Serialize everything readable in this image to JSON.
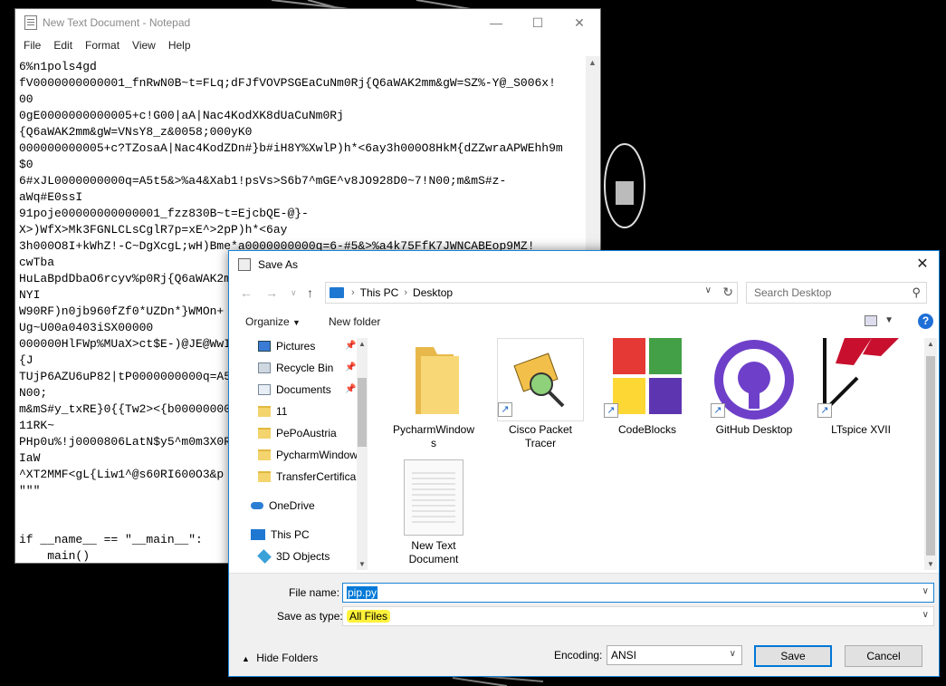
{
  "notepad": {
    "title": "New Text Document - Notepad",
    "menu": [
      "File",
      "Edit",
      "Format",
      "View",
      "Help"
    ],
    "content": "6%n1pols4gd\nfV0000000000001_fnRwN0B~t=FLq;dFJfVOVPSGEaCuNm0Rj{Q6aWAK2mm&gW=SZ%-Y@_S006x!\n00\n0gE0000000000005+c!G00|aA|Nac4KodXK8dUaCuNm0Rj\n{Q6aWAK2mm&gW=VNsY8_z&0058;000yK0\n000000000005+c?TZosaA|Nac4KodZDn#}b#iH8Y%XwlP)h*<6ay3h000O8HkM{dZZwraAPWEhh9m\n$0\n6#xJL0000000000q=A5t5&>%a4&Xab1!psVs>S6b7^mGE^v8JO928D0~7!N00;m&mS#z-\naWq#E0ssI\n91poje00000000000001_fzz830B~t=EjcbQE-@}-\nX>)WfX>Mk3FGNLCLsCglR7p=xE^>2pP)h*<6ay\n3h000O8I+kWhZ!-C~DgXcgL;wH)Bme*a0000000000q=6-#5&>%a4k75FfK7JWNCABEop9MZ!\ncwTba\nHuLaBpdDbaO6rcyv%p0Rj{Q6aWAK2mm&gW=VNsY8_z&0058;000yK0\nNYI\nW90RF)n0jb960fZf0*UZDn*}WMOn+\nUg~U00a0403iSX00000\n000000HlFWp%MUaX>ct$E-)@JE@WwIb#i\n{J\nTUjP6AZU6uP82|tP0000000000q=A5t5&>%a4&Xab1!psVs>S6b7^mGE^v8\nN00;\nm&mS#y_txRE}0{{Tw2><{b000000000000000\n11RK~\nPHp0u%!j0000806LatN$y5^m0m3X0RR9100\nIaW\n^XT2MMF<gL{Liw1^@s60RI600O3&p\n\"\"\"\n\n\nif __name__ == \"__main__\":\n    main()"
  },
  "saveas": {
    "title": "Save As",
    "breadcrumb": [
      "This PC",
      "Desktop"
    ],
    "search_placeholder": "Search Desktop",
    "organize": "Organize",
    "new_folder": "New folder",
    "nav_items": [
      {
        "label": "Pictures",
        "icon": "pictures-icon",
        "pinned": true
      },
      {
        "label": "Recycle Bin",
        "icon": "recycle-bin-icon",
        "pinned": true
      },
      {
        "label": "Documents",
        "icon": "documents-icon",
        "pinned": true
      },
      {
        "label": "11",
        "icon": "folder-icon",
        "pinned": false
      },
      {
        "label": "PePoAustria",
        "icon": "folder-icon",
        "pinned": false
      },
      {
        "label": "PycharmWindow",
        "icon": "folder-icon",
        "pinned": false
      },
      {
        "label": "TransferCertifica",
        "icon": "folder-icon",
        "pinned": false
      },
      {
        "label": "OneDrive",
        "icon": "onedrive-icon",
        "pinned": false
      },
      {
        "label": "This PC",
        "icon": "this-pc-icon",
        "pinned": false
      },
      {
        "label": "3D Objects",
        "icon": "3d-objects-icon",
        "pinned": false
      }
    ],
    "files": [
      {
        "label": "PycharmWindows",
        "icon": "folder-icon"
      },
      {
        "label": "Cisco Packet Tracer",
        "icon": "cisco-packet-tracer-icon"
      },
      {
        "label": "CodeBlocks",
        "icon": "codeblocks-icon"
      },
      {
        "label": "GitHub Desktop",
        "icon": "github-icon"
      },
      {
        "label": "LTspice XVII",
        "icon": "ltspice-icon"
      },
      {
        "label": "New Text Document",
        "icon": "text-document-icon"
      }
    ],
    "file_name_label": "File name:",
    "file_name_value": "pip.py",
    "save_type_label": "Save as type:",
    "save_type_value": "All Files",
    "hide_folders": "Hide Folders",
    "encoding_label": "Encoding:",
    "encoding_value": "ANSI",
    "save_button": "Save",
    "cancel_button": "Cancel"
  }
}
